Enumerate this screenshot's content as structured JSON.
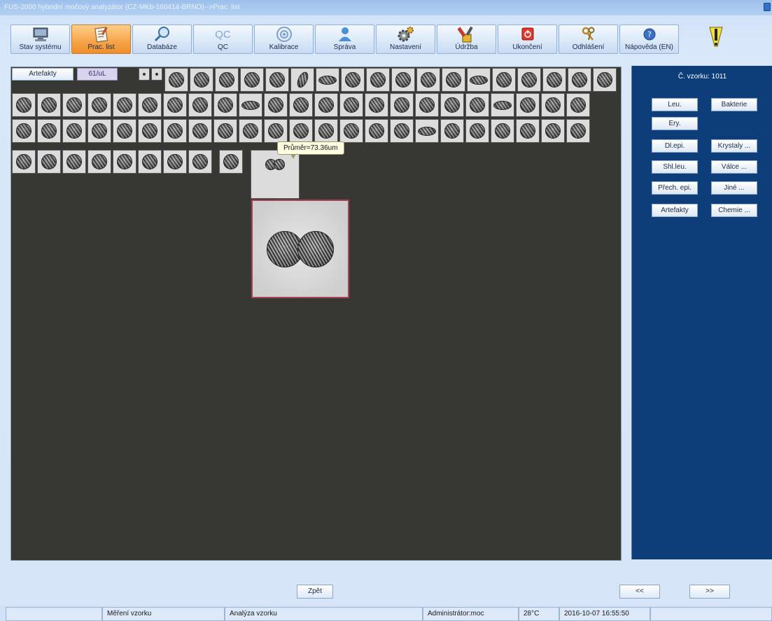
{
  "window": {
    "title": "FUS-2000 hybridní močový analyzátor (CZ-MKb-160414-BRNO)-->Prac. list"
  },
  "toolbar": {
    "buttons": [
      {
        "label": "Stav systému",
        "icon": "monitor-icon"
      },
      {
        "label": "Prac. list",
        "icon": "worklist-icon",
        "active": true
      },
      {
        "label": "Databáze",
        "icon": "magnifier-icon"
      },
      {
        "label": "QC",
        "icon": "qc-icon"
      },
      {
        "label": "Kalibrace",
        "icon": "target-icon"
      },
      {
        "label": "Správa",
        "icon": "user-icon"
      },
      {
        "label": "Nastavení",
        "icon": "gears-icon"
      },
      {
        "label": "Údržba",
        "icon": "tools-icon"
      },
      {
        "label": "Ukončení",
        "icon": "power-icon"
      },
      {
        "label": "Odhlášení",
        "icon": "keys-icon"
      },
      {
        "label": "Nápověda (EN)",
        "icon": "help-icon"
      }
    ],
    "qc_icon_text": "QC",
    "warning_icon": "warning-icon"
  },
  "gallery": {
    "category_label": "Artefakty",
    "count_label": "61/uL",
    "tooltip": "Průměr=73.36um"
  },
  "side": {
    "sample_number": "Č. vzorku: 1011",
    "buttons": {
      "leu": "Leu.",
      "bakterie": "Bakterie",
      "ery": "Ery.",
      "dl_epi": "Dl.epi.",
      "krystaly": "Krystaly ...",
      "shl_leu": "Shl.leu.",
      "valce": "Válce ...",
      "prech_epi": "Přech. epi.",
      "jine": "Jiné ...",
      "artefakty": "Artefakty",
      "chemie": "Chemie ..."
    }
  },
  "nav": {
    "back": "Zpět",
    "prev": "<<",
    "next": ">>"
  },
  "status": {
    "cell1": "",
    "cell2": "Měření vzorku",
    "cell3": "Analýza vzorku",
    "cell4": "Administrátor:moc",
    "temperature": "28°C",
    "datetime": "2016-10-07 16:55:50"
  },
  "colors": {
    "side_panel": "#0d3e7a",
    "gallery_bg": "#373733",
    "active_tab": "#f6a348"
  }
}
